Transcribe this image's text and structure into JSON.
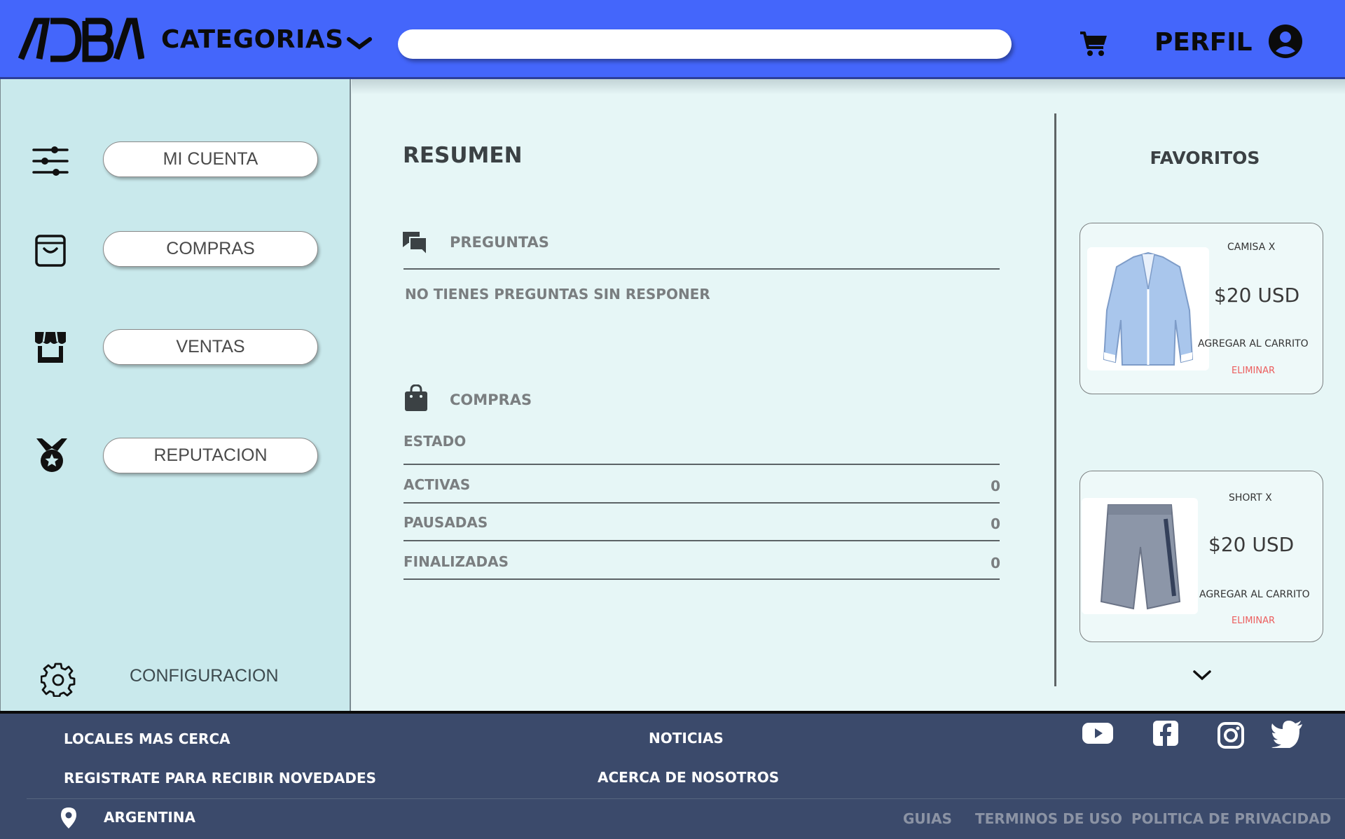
{
  "header": {
    "logo_text": "ADBA",
    "categories_label": "CATEGORIAS",
    "search_placeholder": "",
    "perfil_label": "PERFIL"
  },
  "sidebar": {
    "items": [
      {
        "label": "MI CUENTA",
        "icon": "sliders-icon"
      },
      {
        "label": "COMPRAS",
        "icon": "shopping-bag-icon"
      },
      {
        "label": "VENTAS",
        "icon": "store-icon"
      },
      {
        "label": "REPUTACION",
        "icon": "medal-icon"
      }
    ],
    "config_label": "CONFIGURACION"
  },
  "main": {
    "title": "RESUMEN",
    "preguntas": {
      "title": "PREGUNTAS",
      "empty_text": "NO TIENES PREGUNTAS SIN RESPONER"
    },
    "compras": {
      "title": "COMPRAS",
      "estado_label": "ESTADO",
      "rows": [
        {
          "label": "ACTIVAS",
          "value": "0"
        },
        {
          "label": "PAUSADAS",
          "value": "0"
        },
        {
          "label": "FINALIZADAS",
          "value": "0"
        }
      ]
    }
  },
  "favorites": {
    "title": "FAVORITOS",
    "items": [
      {
        "name": "CAMISA X",
        "price": "$20 USD",
        "add_label": "AGREGAR AL CARRITO",
        "remove_label": "ELIMINAR"
      },
      {
        "name": "SHORT X",
        "price": "$20 USD",
        "add_label": "AGREGAR AL CARRITO",
        "remove_label": "ELIMINAR"
      }
    ]
  },
  "footer": {
    "locales": "LOCALES MAS CERCA",
    "registrate": "REGISTRATE PARA RECIBIR NOVEDADES",
    "noticias": "NOTICIAS",
    "acerca": "ACERCA DE NOSOTROS",
    "country": "ARGENTINA",
    "guias": "GUIAS",
    "terminos": "TERMINOS DE USO",
    "privacidad": "POLITICA DE PRIVACIDAD",
    "social": [
      "youtube-icon",
      "facebook-icon",
      "instagram-icon",
      "twitter-icon"
    ]
  },
  "colors": {
    "header_bg": "#4466fb",
    "sidebar_bg": "#c9e9ec",
    "main_bg": "#e6f6f6",
    "footer_bg": "#3b4a6b",
    "remove_text": "#ec5e5e"
  }
}
